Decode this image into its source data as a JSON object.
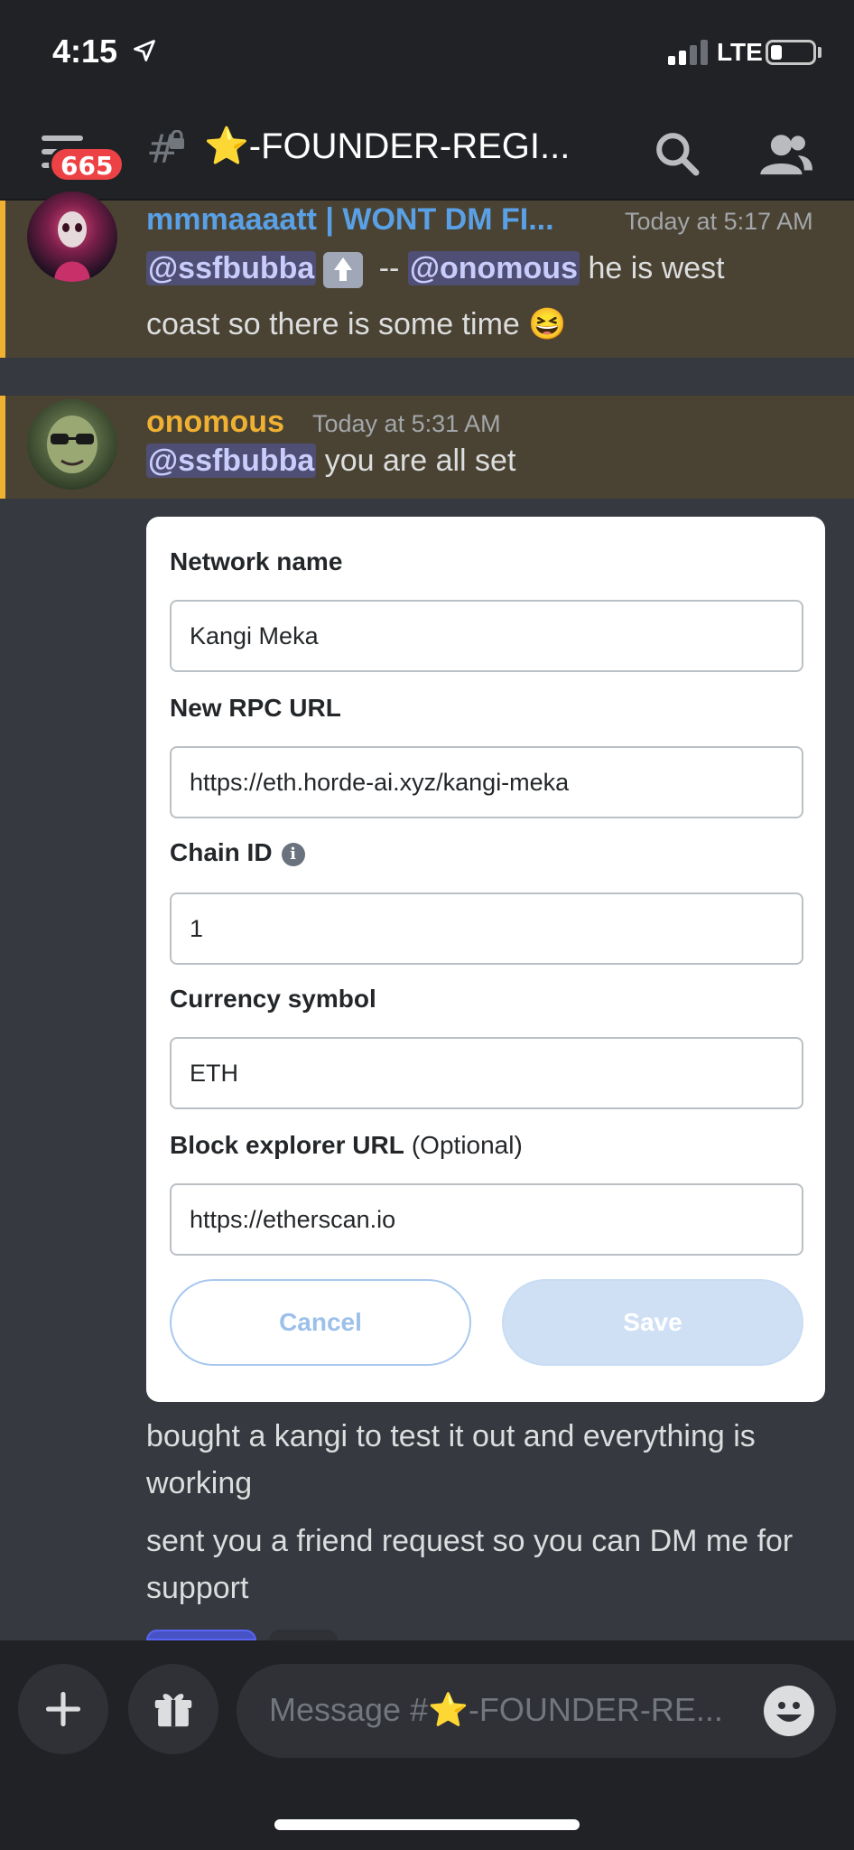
{
  "status_bar": {
    "time": "4:15",
    "network": "LTE"
  },
  "header": {
    "unread_badge": "665",
    "channel_title": "⭐-FOUNDER-REGI..."
  },
  "messages": [
    {
      "username": "mmmaaaatt | WONT DM FI...",
      "username_color": "#5aa0e6",
      "timestamp": "Today at 5:17 AM",
      "mention_1": "@ssfbubba",
      "separator": "--",
      "mention_2": "@onomous",
      "text_after": "he is west",
      "text_line2": "coast so there is some time",
      "emoji": "😆"
    },
    {
      "username": "onomous",
      "username_color": "#f0b132",
      "timestamp": "Today at 5:31 AM",
      "mention": "@ssfbubba",
      "text": "you are all set"
    }
  ],
  "embed": {
    "fields": [
      {
        "label": "Network name",
        "value": "Kangi Meka"
      },
      {
        "label": "New RPC URL",
        "value": "https://eth.horde-ai.xyz/kangi-meka"
      },
      {
        "label": "Chain ID",
        "value": "1"
      },
      {
        "label": "Currency symbol",
        "value": "ETH"
      },
      {
        "label": "Block explorer URL",
        "optional": "(Optional)",
        "value": "https://etherscan.io"
      }
    ],
    "cancel_label": "Cancel",
    "save_label": "Save"
  },
  "follow_up": [
    "bought a kangi to test it out and everything is working",
    "sent you a friend request so you can DM me for support"
  ],
  "composer": {
    "placeholder": "Message #⭐-FOUNDER-RE..."
  },
  "colors": {
    "mention_bg": "#5865f2",
    "highlight_border": "#f0b132",
    "badge": "#ed4245"
  }
}
